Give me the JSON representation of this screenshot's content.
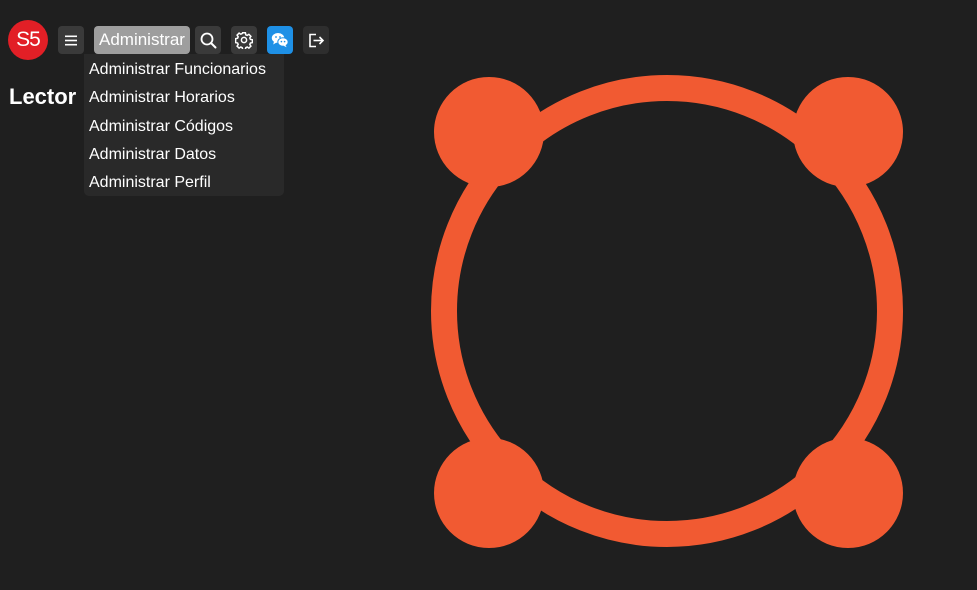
{
  "logo": {
    "text": "S5",
    "color": "#e21f26"
  },
  "toolbar": {
    "menu_icon": "hamburger-menu-icon",
    "admin_label": "Administrar",
    "search_icon": "search-icon",
    "settings_icon": "gear-icon",
    "chat_icon": "wechat-icon",
    "logout_icon": "logout-icon"
  },
  "admin_menu": {
    "items": [
      "Administrar Funcionarios",
      "Administrar Horarios",
      "Administrar Códigos",
      "Administrar Datos",
      "Administrar Perfil"
    ]
  },
  "page": {
    "heading": "Lector"
  },
  "emblem": {
    "icon": "connected-circle-emblem",
    "color": "#f15a32"
  },
  "colors": {
    "background": "#1f1f1f",
    "button_dark": "#3a3a3a",
    "chat_blue": "#1e90e6",
    "admin_active": "#9e9e9e",
    "menu_bg": "#292929"
  }
}
